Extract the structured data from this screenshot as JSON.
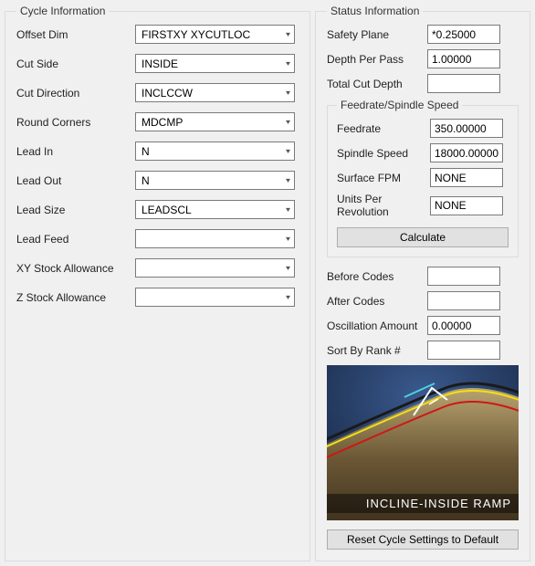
{
  "cycle": {
    "legend": "Cycle Information",
    "fields": {
      "offset_dim": {
        "label": "Offset Dim",
        "value": "FIRSTXY XYCUTLOC"
      },
      "cut_side": {
        "label": "Cut Side",
        "value": "INSIDE"
      },
      "cut_direction": {
        "label": "Cut Direction",
        "value": "INCLCCW"
      },
      "round_corners": {
        "label": "Round Corners",
        "value": "MDCMP"
      },
      "lead_in": {
        "label": "Lead In",
        "value": "N"
      },
      "lead_out": {
        "label": "Lead Out",
        "value": "N"
      },
      "lead_size": {
        "label": "Lead Size",
        "value": "LEADSCL"
      },
      "lead_feed": {
        "label": "Lead Feed",
        "value": ""
      },
      "xy_stock": {
        "label": "XY Stock Allowance",
        "value": ""
      },
      "z_stock": {
        "label": "Z Stock Allowance",
        "value": ""
      }
    }
  },
  "status": {
    "legend": "Status Information",
    "fields": {
      "safety_plane": {
        "label": "Safety Plane",
        "value": "*0.25000"
      },
      "depth_per_pass": {
        "label": "Depth Per Pass",
        "value": "1.00000"
      },
      "total_cut_depth": {
        "label": "Total Cut Depth",
        "value": ""
      },
      "before_codes": {
        "label": "Before Codes",
        "value": ""
      },
      "after_codes": {
        "label": "After Codes",
        "value": ""
      },
      "oscillation": {
        "label": "Oscillation Amount",
        "value": "0.00000"
      },
      "sort_by_rank": {
        "label": "Sort By Rank #",
        "value": ""
      }
    },
    "feedrate": {
      "legend": "Feedrate/Spindle Speed",
      "fields": {
        "feedrate": {
          "label": "Feedrate",
          "value": "350.00000"
        },
        "spindle_speed": {
          "label": "Spindle Speed",
          "value": "18000.00000"
        },
        "surface_fpm": {
          "label": "Surface FPM",
          "value": "NONE"
        },
        "units_per_rev": {
          "label": "Units Per Revolution",
          "value": "NONE"
        }
      },
      "calculate_label": "Calculate"
    },
    "image_caption": "INCLINE-INSIDE RAMP",
    "reset_label": "Reset Cycle Settings to Default"
  }
}
